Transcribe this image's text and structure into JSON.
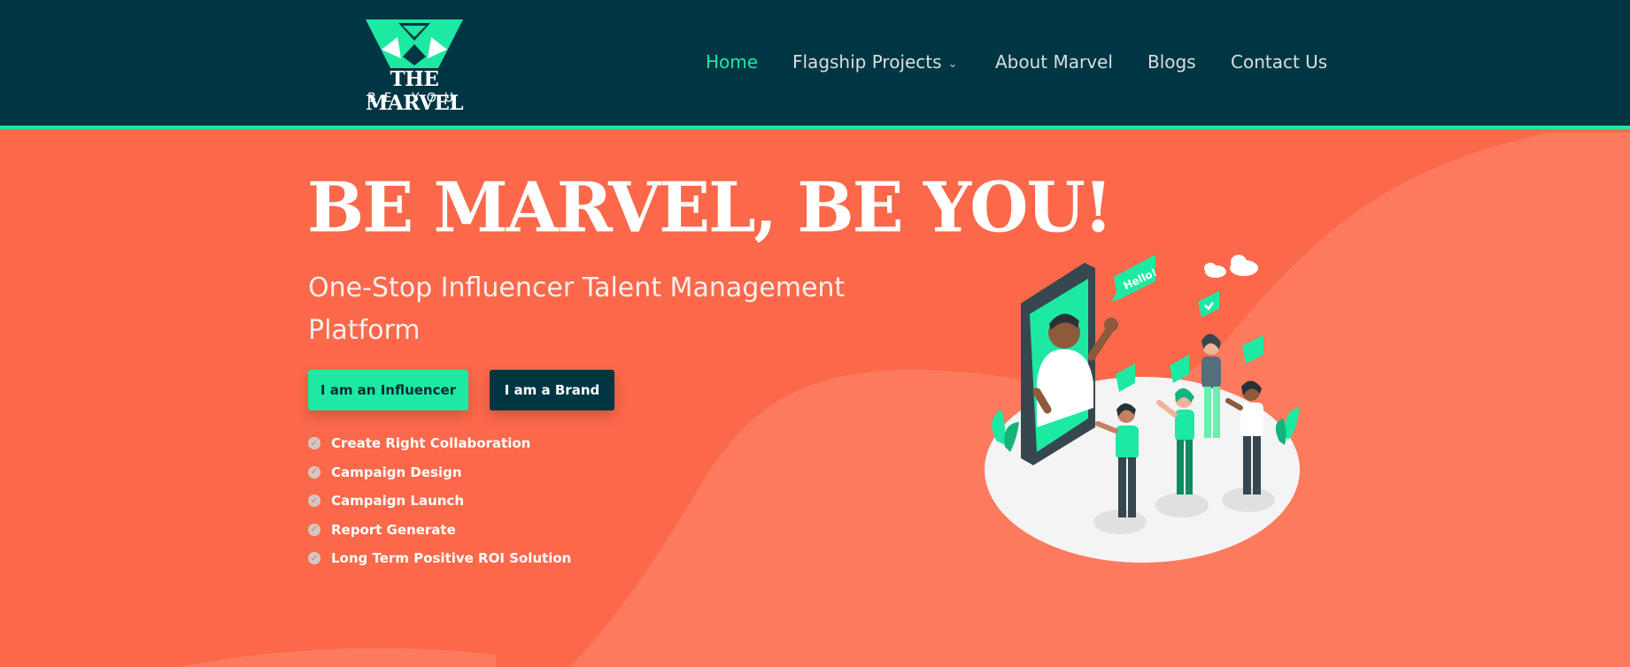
{
  "header": {
    "logo": {
      "title": "THE MARVEL",
      "subtitle": "BE YOU"
    },
    "nav": [
      {
        "label": "Home",
        "active": true
      },
      {
        "label": "Flagship Projects",
        "has_dropdown": true
      },
      {
        "label": "About Marvel"
      },
      {
        "label": "Blogs"
      },
      {
        "label": "Contact Us"
      }
    ]
  },
  "hero": {
    "headline": "BE MARVEL, BE YOU!",
    "subheadline": "One-Stop Influencer Talent Management Platform",
    "buttons": {
      "influencer": "I am an Influencer",
      "brand": "I am a Brand"
    },
    "features": [
      "Create Right Collaboration",
      "Campaign Design",
      "Campaign Launch",
      "Report Generate",
      "Long Term Positive ROI Solution"
    ],
    "illustration": {
      "bubble_text": "Hello!"
    }
  },
  "colors": {
    "header_bg": "#003644",
    "accent": "#1de9a2",
    "hero_bg": "#fb684a",
    "hero_wave": "#fc7a5e"
  },
  "icons": [
    "chevron-down-icon",
    "check-circle-icon",
    "heart-icon",
    "thumbs-up-icon",
    "cloud-icon"
  ]
}
